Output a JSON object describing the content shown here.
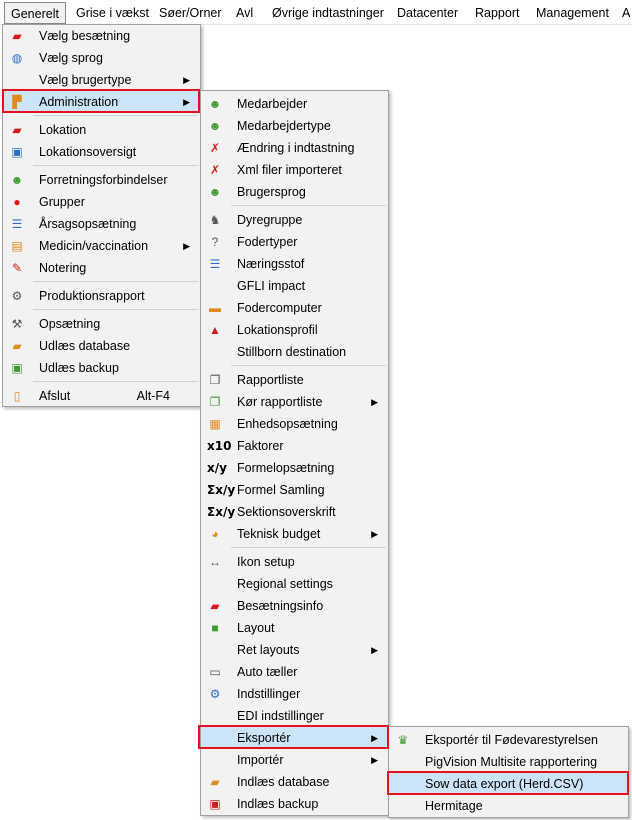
{
  "menubar": {
    "items": [
      "Generelt",
      "Grise i vækst",
      "Søer/Orner",
      "Avl",
      "Øvrige indtastninger",
      "Datacenter",
      "Rapport",
      "Management",
      "A"
    ]
  },
  "menu1": {
    "items": [
      {
        "label": "Vælg besætning",
        "icon": "farm-icon"
      },
      {
        "label": "Vælg sprog",
        "icon": "globe-icon"
      },
      {
        "label": "Vælg brugertype",
        "icon": "",
        "submenu": true
      },
      {
        "label": "Administration",
        "icon": "admin-icon",
        "submenu": true
      },
      {
        "label": "Lokation",
        "icon": "location-icon"
      },
      {
        "label": "Lokationsoversigt",
        "icon": "location-overview-icon"
      },
      {
        "label": "Forretningsforbindelser",
        "icon": "business-icon"
      },
      {
        "label": "Grupper",
        "icon": "groups-icon"
      },
      {
        "label": "Årsagsopsætning",
        "icon": "list-icon"
      },
      {
        "label": "Medicin/vaccination",
        "icon": "medicine-icon",
        "submenu": true
      },
      {
        "label": "Notering",
        "icon": "note-icon"
      },
      {
        "label": "Produktionsrapport",
        "icon": "report-icon"
      },
      {
        "label": "Opsætning",
        "icon": "wrench-icon"
      },
      {
        "label": "Udlæs database",
        "icon": "export-db-icon"
      },
      {
        "label": "Udlæs backup",
        "icon": "backup-icon"
      },
      {
        "label": "Afslut",
        "icon": "exit-icon",
        "shortcut": "Alt-F4"
      }
    ]
  },
  "menu2": {
    "items": [
      {
        "label": "Medarbejder"
      },
      {
        "label": "Medarbejdertype"
      },
      {
        "label": "Ændring i indtastning"
      },
      {
        "label": "Xml filer importeret"
      },
      {
        "label": "Brugersprog"
      },
      {
        "label": "Dyregruppe"
      },
      {
        "label": "Fodertyper"
      },
      {
        "label": "Næringsstof"
      },
      {
        "label": "GFLI impact"
      },
      {
        "label": "Fodercomputer"
      },
      {
        "label": "Lokationsprofil"
      },
      {
        "label": "Stillborn destination"
      },
      {
        "label": "Rapportliste"
      },
      {
        "label": "Kør rapportliste",
        "submenu": true
      },
      {
        "label": "Enhedsopsætning"
      },
      {
        "label": "Faktorer",
        "iconText": "x10"
      },
      {
        "label": "Formelopsætning",
        "iconText": "x/y"
      },
      {
        "label": "Formel Samling",
        "iconText": "Σx/y"
      },
      {
        "label": "Sektionsoverskrift",
        "iconText": "Σx/y"
      },
      {
        "label": "Teknisk budget",
        "submenu": true
      },
      {
        "label": "Ikon setup"
      },
      {
        "label": "Regional settings"
      },
      {
        "label": "Besætningsinfo"
      },
      {
        "label": "Layout"
      },
      {
        "label": "Ret layouts",
        "submenu": true
      },
      {
        "label": "Auto tæller"
      },
      {
        "label": "Indstillinger"
      },
      {
        "label": "EDI indstillinger"
      },
      {
        "label": "Eksportér",
        "submenu": true
      },
      {
        "label": "Importér",
        "submenu": true
      },
      {
        "label": "Indlæs database"
      },
      {
        "label": "Indlæs backup"
      }
    ]
  },
  "menu3": {
    "items": [
      {
        "label": "Eksportér til Fødevarestyrelsen"
      },
      {
        "label": "PigVision Multisite rapportering"
      },
      {
        "label": "Sow data export (Herd.CSV)"
      },
      {
        "label": "Hermitage"
      }
    ]
  }
}
